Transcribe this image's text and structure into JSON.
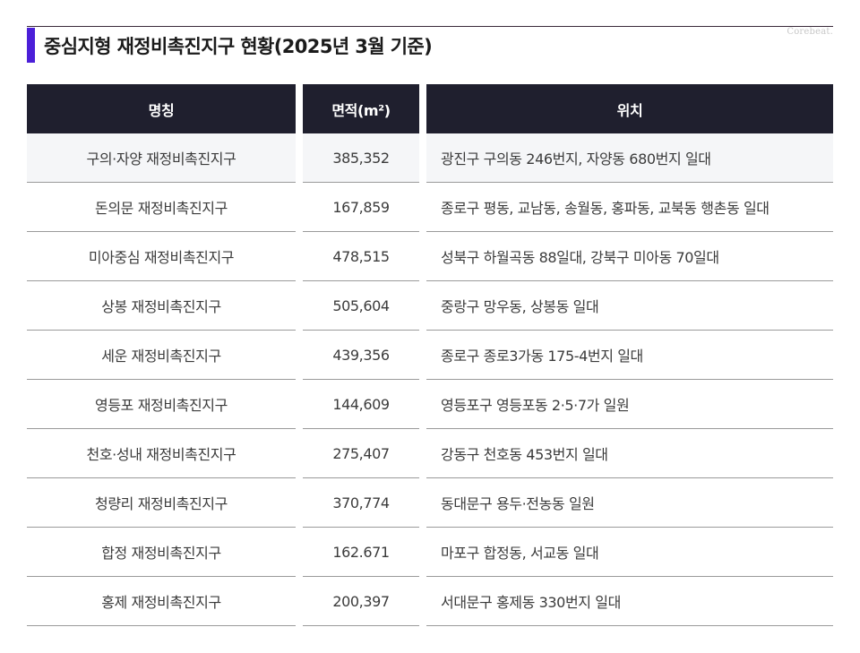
{
  "title": "중심지형 재정비촉진지구 현황(2025년 3월 기준)",
  "watermark": "Corebeat.",
  "table": {
    "headers": [
      "명칭",
      "면적(m²)",
      "위치"
    ],
    "rows": [
      [
        "구의·자양 재정비촉진지구",
        "385,352",
        "광진구 구의동 246번지, 자양동 680번지 일대"
      ],
      [
        "돈의문 재정비촉진지구",
        "167,859",
        "종로구 평동, 교남동, 송월동, 홍파동, 교북동 행촌동 일대"
      ],
      [
        "미아중심 재정비촉진지구",
        "478,515",
        "성북구 하월곡동 88일대, 강북구 미아동 70일대"
      ],
      [
        "상봉 재정비촉진지구",
        "505,604",
        "중랑구 망우동, 상봉동 일대"
      ],
      [
        "세운 재정비촉진지구",
        "439,356",
        "종로구 종로3가동 175-4번지 일대"
      ],
      [
        "영등포 재정비촉진지구",
        "144,609",
        "영등포구 영등포동 2·5·7가 일원"
      ],
      [
        "천호·성내 재정비촉진지구",
        "275,407",
        "강동구 천호동 453번지 일대"
      ],
      [
        "청량리 재정비촉진지구",
        "370,774",
        "동대문구 용두·전농동 일원"
      ],
      [
        "합정 재정비촉진지구",
        "162.671",
        "마포구 합정동, 서교동 일대"
      ],
      [
        "홍제 재정비촉진지구",
        "200,397",
        "서대문구 홍제동 330번지 일대"
      ]
    ]
  }
}
